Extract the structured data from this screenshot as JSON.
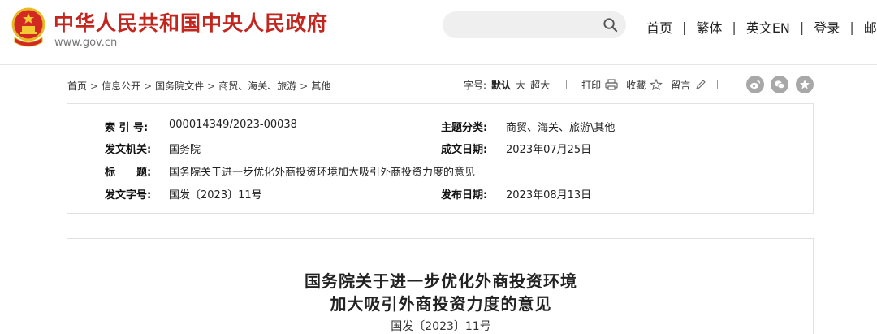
{
  "header": {
    "site_title": "中华人民共和国中央人民政府",
    "site_url": "www.gov.cn",
    "search_placeholder": "",
    "nav": [
      "首页",
      "繁体",
      "英文EN",
      "登录",
      "邮箱"
    ],
    "nav_separator": "|"
  },
  "breadcrumb": {
    "items": [
      "首页",
      "信息公开",
      "国务院文件",
      "商贸、海关、旅游",
      "其他"
    ],
    "separator": ">"
  },
  "tools": {
    "font_size_label": "字号:",
    "font_default": "默认",
    "font_large": "大",
    "font_xlarge": "超大",
    "print_label": "打印",
    "favorite_label": "收藏",
    "comment_label": "留言"
  },
  "share_icons": [
    "weibo-icon",
    "wechat-icon",
    "qzone-icon"
  ],
  "metadata": {
    "index_label": "索 引 号:",
    "index_value": "000014349/2023-00038",
    "category_label": "主题分类:",
    "category_value": "商贸、海关、旅游\\其他",
    "issuer_label": "发文机关:",
    "issuer_value": "国务院",
    "written_date_label": "成文日期:",
    "written_date_value": "2023年07月25日",
    "title_label": "标　　题:",
    "title_value": "国务院关于进一步优化外商投资环境加大吸引外商投资力度的意见",
    "doc_number_label": "发文字号:",
    "doc_number_value": "国发〔2023〕11号",
    "publish_date_label": "发布日期:",
    "publish_date_value": "2023年08月13日"
  },
  "document": {
    "title_line1": "国务院关于进一步优化外商投资环境",
    "title_line2": "加大吸引外商投资力度的意见",
    "doc_number": "国发〔2023〕11号"
  },
  "colors": {
    "brand_red": "#c3261f",
    "emblem_gold": "#e8b923"
  }
}
